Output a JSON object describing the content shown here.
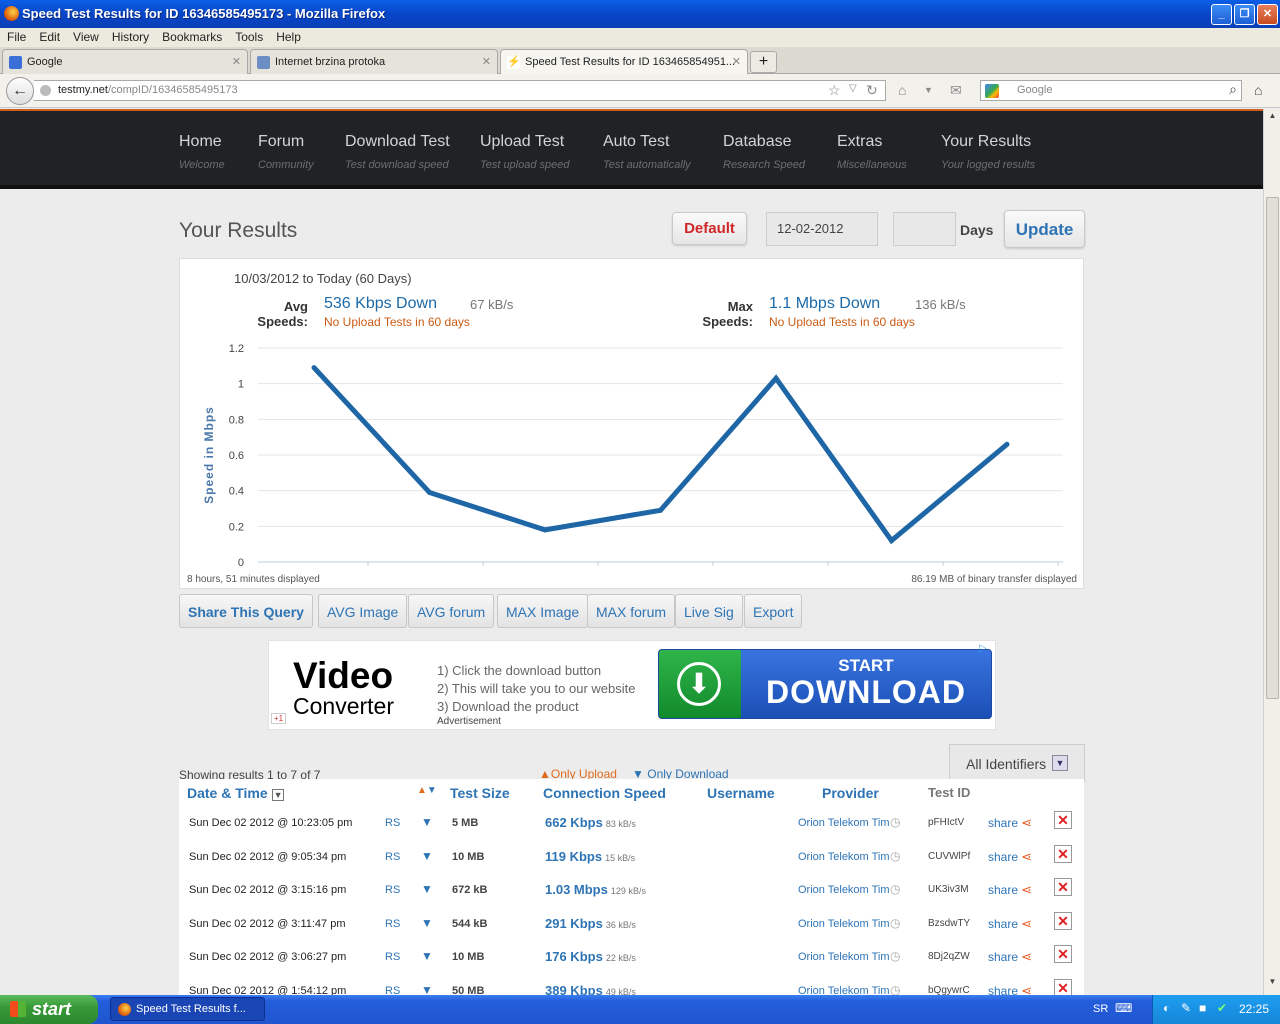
{
  "window": {
    "title": "Speed Test Results for ID 16346585495173 - Mozilla Firefox"
  },
  "menu": [
    "File",
    "Edit",
    "View",
    "History",
    "Bookmarks",
    "Tools",
    "Help"
  ],
  "tabs": [
    {
      "label": "Google"
    },
    {
      "label": "Internet brzina protoka"
    },
    {
      "label": "Speed Test Results for ID 163465854951..."
    }
  ],
  "url": {
    "host": "testmy.net",
    "path": "/compID/16346585495173"
  },
  "search": {
    "placeholder": "Google"
  },
  "sitenav": [
    {
      "label": "Home",
      "sub": "Welcome"
    },
    {
      "label": "Forum",
      "sub": "Community"
    },
    {
      "label": "Download Test",
      "sub": "Test download speed"
    },
    {
      "label": "Upload Test",
      "sub": "Test upload speed"
    },
    {
      "label": "Auto Test",
      "sub": "Test automatically"
    },
    {
      "label": "Database",
      "sub": "Research Speed"
    },
    {
      "label": "Extras",
      "sub": "Miscellaneous"
    },
    {
      "label": "Your Results",
      "sub": "Your logged results"
    }
  ],
  "results": {
    "title": "Your Results",
    "default_btn": "Default",
    "date_value": "12-02-2012",
    "days_value": "",
    "days_label": "Days",
    "update_btn": "Update"
  },
  "summary": {
    "range": "10/03/2012 to Today (60 Days)",
    "avg_label_1": "Avg",
    "avg_label_2": "Speeds:",
    "avg_down": "536 Kbps Down",
    "avg_kbs": "67 kB/s",
    "avg_upload": "No Upload Tests in 60 days",
    "max_label_1": "Max",
    "max_label_2": "Speeds:",
    "max_down": "1.1 Mbps Down",
    "max_kbs": "136 kB/s",
    "max_upload": "No Upload Tests in 60 days",
    "footer_left": "8 hours, 51 minutes displayed",
    "footer_right": "86.19 MB of binary transfer displayed"
  },
  "chart_data": {
    "type": "line",
    "ylabel": "Speed in Mbps",
    "xlabel": "",
    "ylim": [
      0,
      1.2
    ],
    "yticks": [
      "0",
      "0.2",
      "0.4",
      "0.6",
      "0.8",
      "1",
      "1.2"
    ],
    "series": [
      {
        "values": [
          1.09,
          0.39,
          0.18,
          0.29,
          1.03,
          0.12,
          0.66
        ]
      }
    ],
    "grid": true,
    "color": "#1f66a6"
  },
  "query_buttons": [
    "Share This Query",
    "AVG Image",
    "AVG forum",
    "MAX Image",
    "MAX forum",
    "Live Sig",
    "Export"
  ],
  "ad": {
    "title": "Video",
    "subtitle": "Converter",
    "steps": [
      "1) Click the download button",
      "2) This will take you to our website",
      "3) Download the product"
    ],
    "btn_top": "START",
    "btn_bottom": "DOWNLOAD",
    "label": "Advertisement",
    "gplus": "+1"
  },
  "list": {
    "showing": "Showing results 1 to 7 of 7",
    "only_upload": "Only Upload",
    "only_download": "Only Download",
    "identifiers": "All Identifiers",
    "headers": {
      "date": "Date & Time",
      "size": "Test Size",
      "speed": "Connection Speed",
      "user": "Username",
      "provider": "Provider",
      "testid": "Test ID"
    },
    "rows": [
      {
        "date": "Sun Dec 02 2012 @ 10:23:05 pm",
        "rs": "RS",
        "size": "5 MB",
        "speed": "662 Kbps",
        "kbs": "83 kB/s",
        "provider": "Orion Telekom Tim",
        "id": "pFHIctV",
        "share": "share"
      },
      {
        "date": "Sun Dec 02 2012 @ 9:05:34 pm",
        "rs": "RS",
        "size": "10 MB",
        "speed": "119 Kbps",
        "kbs": "15 kB/s",
        "provider": "Orion Telekom Tim",
        "id": "CUVWlPf",
        "share": "share"
      },
      {
        "date": "Sun Dec 02 2012 @ 3:15:16 pm",
        "rs": "RS",
        "size": "672 kB",
        "speed": "1.03 Mbps",
        "kbs": "129 kB/s",
        "provider": "Orion Telekom Tim",
        "id": "UK3iv3M",
        "share": "share"
      },
      {
        "date": "Sun Dec 02 2012 @ 3:11:47 pm",
        "rs": "RS",
        "size": "544 kB",
        "speed": "291 Kbps",
        "kbs": "36 kB/s",
        "provider": "Orion Telekom Tim",
        "id": "BzsdwTY",
        "share": "share"
      },
      {
        "date": "Sun Dec 02 2012 @ 3:06:27 pm",
        "rs": "RS",
        "size": "10 MB",
        "speed": "176 Kbps",
        "kbs": "22 kB/s",
        "provider": "Orion Telekom Tim",
        "id": "8Dj2qZW",
        "share": "share"
      },
      {
        "date": "Sun Dec 02 2012 @ 1:54:12 pm",
        "rs": "RS",
        "size": "50 MB",
        "speed": "389 Kbps",
        "kbs": "49 kB/s",
        "provider": "Orion Telekom Tim",
        "id": "bQgywrC",
        "share": "share"
      }
    ]
  },
  "taskbar": {
    "start": "start",
    "item": "Speed Test Results f...",
    "lang": "SR",
    "clock": "22:25"
  }
}
